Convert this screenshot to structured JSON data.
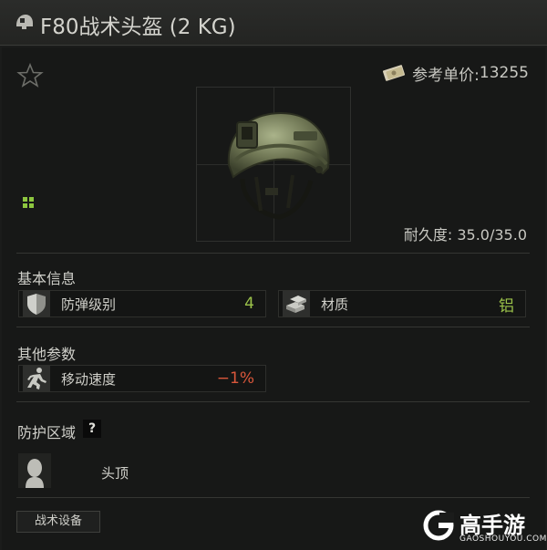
{
  "window": {
    "title": "F80战术头盔 (2 KG)"
  },
  "item": {
    "price_label": "参考单价:",
    "price_value": "13255",
    "durability": "耐久度: 35.0/35.0"
  },
  "basic_info": {
    "title": "基本信息",
    "stats": [
      {
        "label": "防弹级别",
        "value": "4",
        "icon": "shield-icon",
        "color": "#9bc24a"
      },
      {
        "label": "材质",
        "value": "铝",
        "icon": "metal-bars-icon",
        "color": "#9bc24a"
      }
    ]
  },
  "other_params": {
    "title": "其他参数",
    "stats": [
      {
        "label": "移动速度",
        "value": "−1%",
        "icon": "running-person-icon",
        "color": "#d9573b"
      }
    ]
  },
  "protection": {
    "title": "防护区域",
    "help": "?",
    "zone_label": "头顶"
  },
  "tag": {
    "label": "战术设备"
  },
  "watermark": {
    "name": "高手游",
    "url": "GAOSHOUYOU.COM"
  }
}
